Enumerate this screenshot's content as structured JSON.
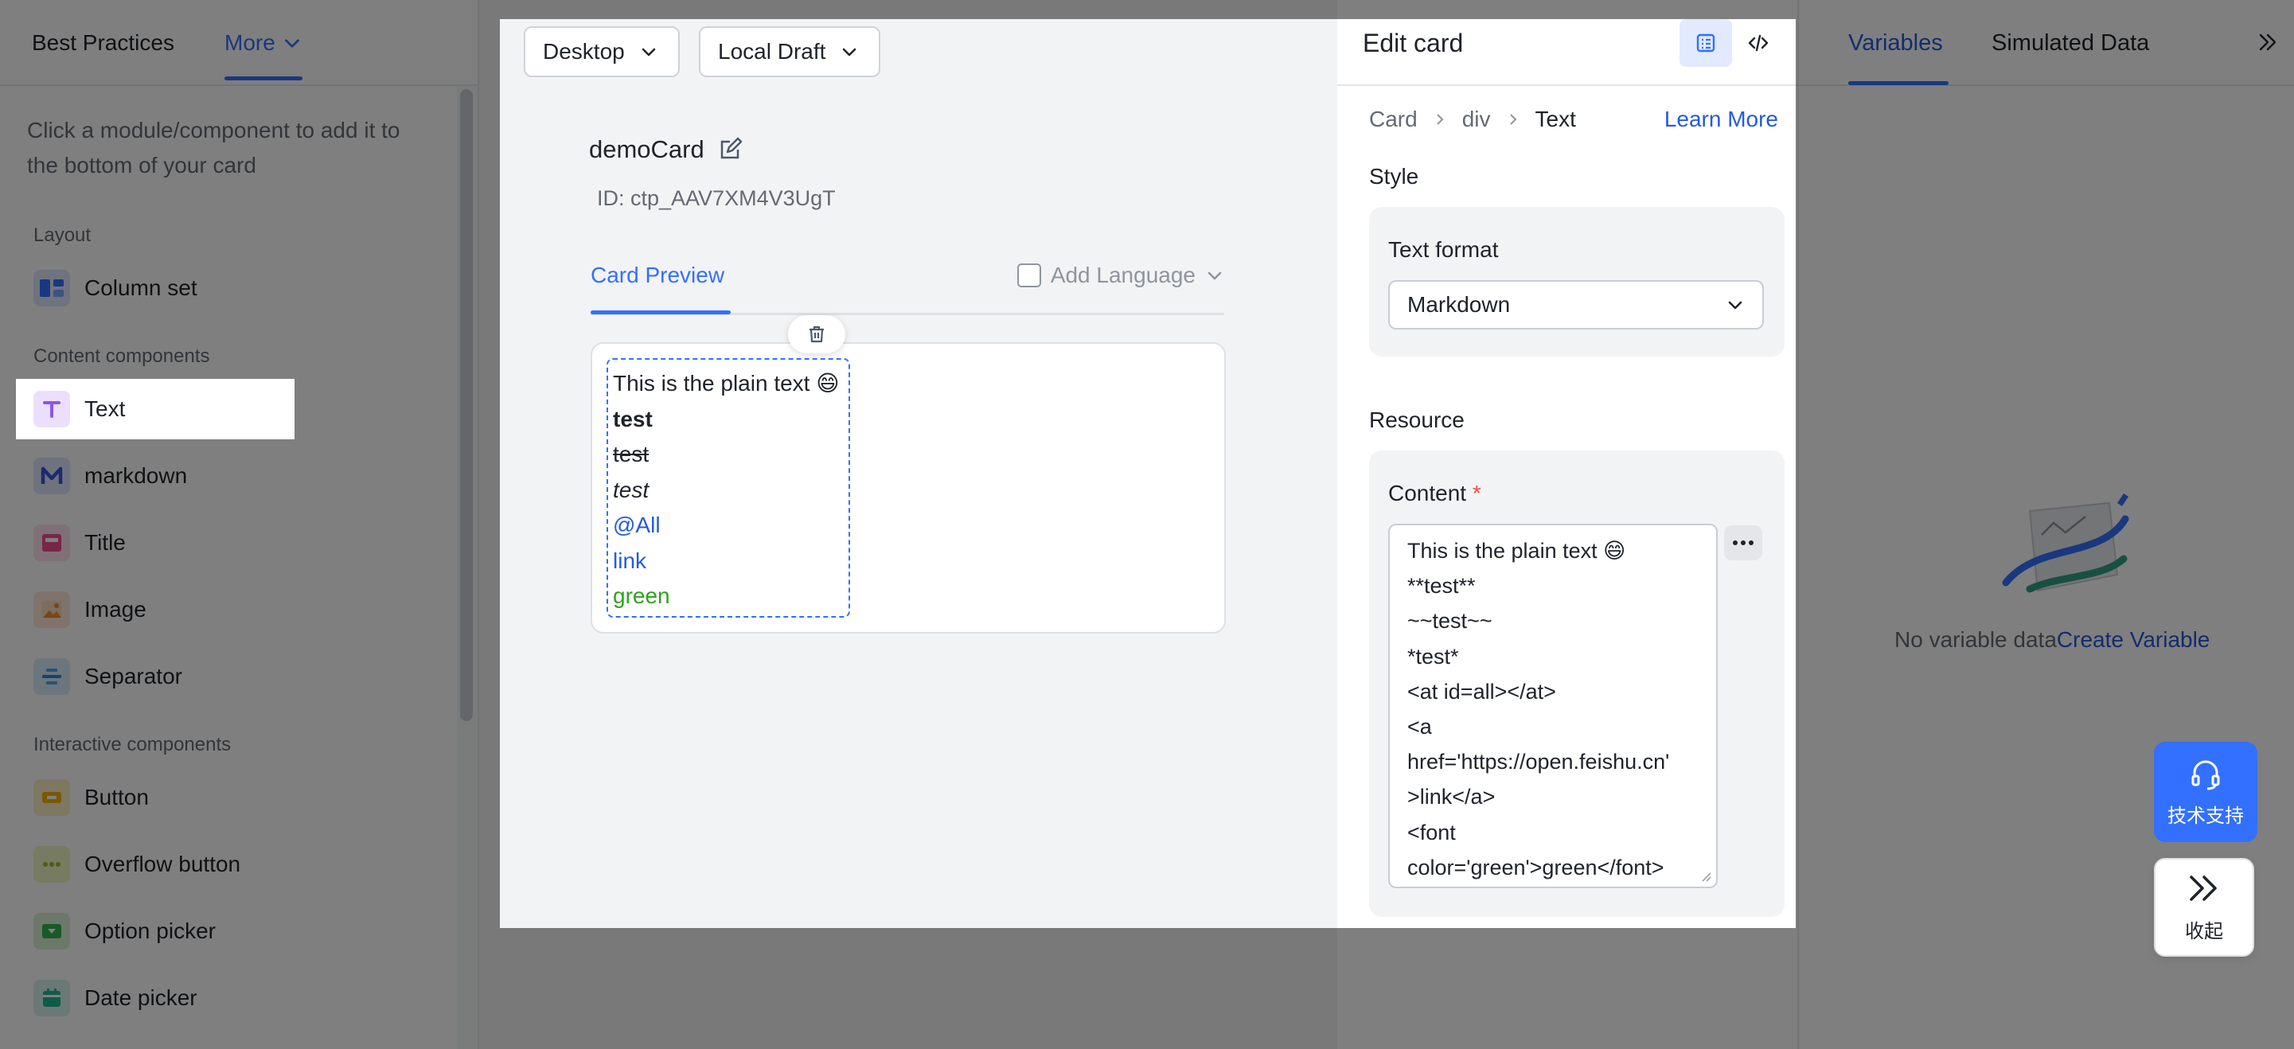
{
  "left": {
    "tabs": [
      "Best Practices",
      "More"
    ],
    "hint": "Click a module/component to add it to the bottom of your card",
    "sections": {
      "layout": "Layout",
      "content": "Content components",
      "interactive": "Interactive components"
    },
    "items": {
      "column_set": "Column set",
      "text": "Text",
      "markdown": "markdown",
      "title": "Title",
      "image": "Image",
      "separator": "Separator",
      "button": "Button",
      "overflow_button": "Overflow button",
      "option_picker": "Option picker",
      "date_picker": "Date picker"
    }
  },
  "preview": {
    "device": "Desktop",
    "version": "Local Draft",
    "card_name": "demoCard",
    "card_id": "ID: ctp_AAV7XM4V3UgT",
    "tab": "Card Preview",
    "add_language": "Add Language",
    "lines": [
      "This is the plain text 😄",
      "test",
      "test",
      "test",
      "@All",
      "link",
      "green"
    ]
  },
  "edit": {
    "title": "Edit card",
    "breadcrumb": [
      "Card",
      "div",
      "Text"
    ],
    "learn_more": "Learn More",
    "style_title": "Style",
    "text_format_label": "Text format",
    "text_format_value": "Markdown",
    "resource_title": "Resource",
    "content_label": "Content",
    "required_mark": "*",
    "content_lines": [
      "This is the plain text 😄",
      "**test**",
      "~~test~~",
      "*test*",
      "<at id=all></at>",
      "<a",
      "href='https://open.feishu.cn'",
      ">link</a>",
      "<font",
      "color='green'>green</font>"
    ]
  },
  "right": {
    "tabs": [
      "Variables",
      "Simulated Data"
    ],
    "empty_text": "No variable data",
    "create_link": "Create Variable",
    "support_label": "技术支持",
    "collapse_label": "收起"
  },
  "colors": {
    "accent": "#3370ff",
    "link": "#245bdb",
    "green": "#2ea121",
    "required": "#f54a45"
  }
}
